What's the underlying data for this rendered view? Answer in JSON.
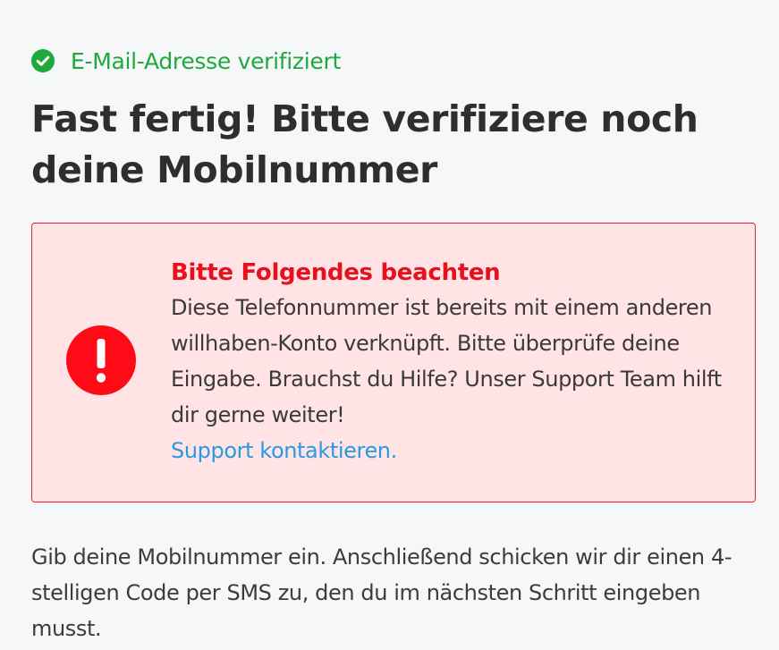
{
  "status": {
    "verified_text": "E-Mail-Adresse verifiziert",
    "icon": "check-circle-icon",
    "color": "#1ea93b"
  },
  "page": {
    "title": "Fast fertig! Bitte verifiziere noch deine Mobilnummer"
  },
  "alert": {
    "icon": "exclamation-circle-icon",
    "title": "Bitte Folgendes beachten",
    "message": "Diese Telefonnummer ist bereits mit einem anderen willhaben-Konto verknüpft. Bitte überprüfe deine Eingabe. Brauchst du Hilfe? Unser Support Team hilft dir gerne weiter!",
    "link_text": "Support kontaktieren.",
    "accent_color": "#e81d2d",
    "background_color": "#ffe3e5",
    "link_color": "#2a9ae0"
  },
  "instructions": {
    "text": "Gib deine Mobilnummer ein. Anschließend schicken wir dir einen 4-stelligen Code per SMS zu, den du im nächsten Schritt eingeben musst."
  }
}
